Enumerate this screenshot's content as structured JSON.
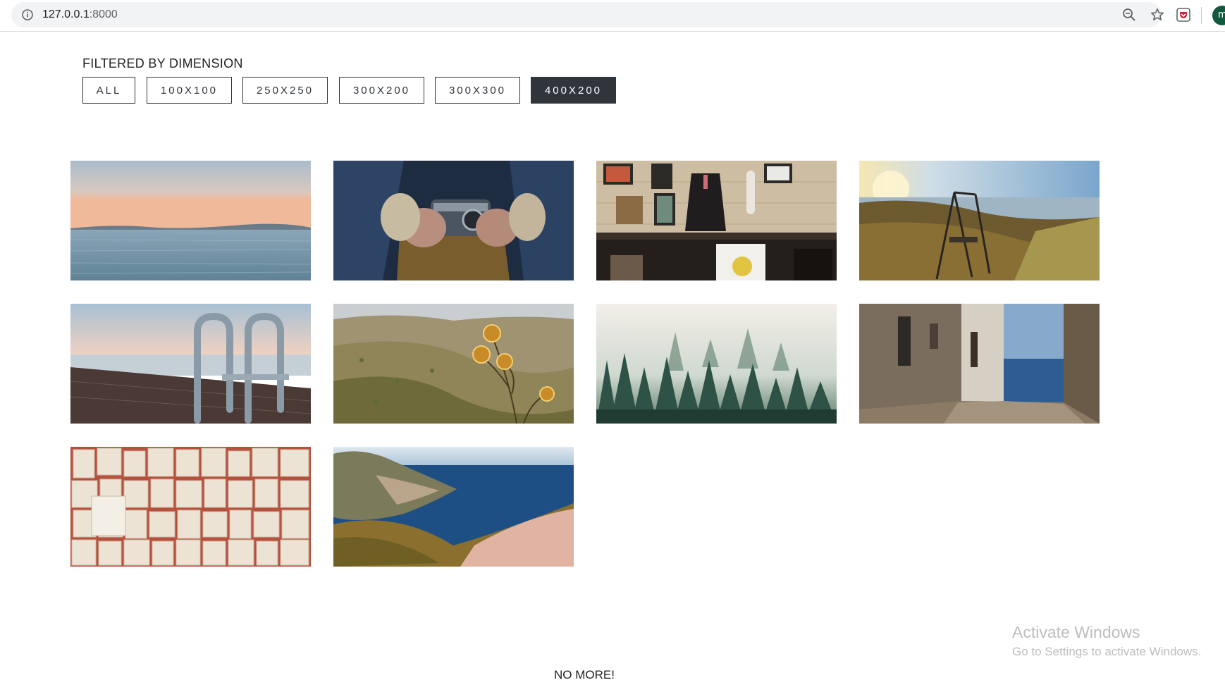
{
  "browser": {
    "url_host": "127.0.0.1",
    "url_port": ":8000",
    "avatar_initial": "m"
  },
  "filter": {
    "heading": "FILTERED BY DIMENSION",
    "options": [
      {
        "label": "ALL",
        "active": false
      },
      {
        "label": "100X100",
        "active": false
      },
      {
        "label": "250X250",
        "active": false
      },
      {
        "label": "300X200",
        "active": false
      },
      {
        "label": "300X300",
        "active": false
      },
      {
        "label": "400X200",
        "active": true
      }
    ]
  },
  "gallery": {
    "images": [
      "sea-horizon-sunset",
      "hands-holding-camera",
      "clothing-shop-interior",
      "swing-by-the-sea",
      "dock-ladder-at-lake",
      "thistle-over-hills",
      "misty-pine-forest",
      "alley-to-the-sea",
      "open-book-pages",
      "coastal-cliff-bay"
    ]
  },
  "footer": {
    "status": "NO MORE!"
  },
  "watermark": {
    "title": "Activate Windows",
    "subtitle": "Go to Settings to activate Windows."
  },
  "colors": {
    "active_filter_bg": "#2f353b",
    "filter_border": "#2f353b",
    "omnibox_bg": "#f1f3f4",
    "avatar_bg": "#0f5a3d"
  }
}
